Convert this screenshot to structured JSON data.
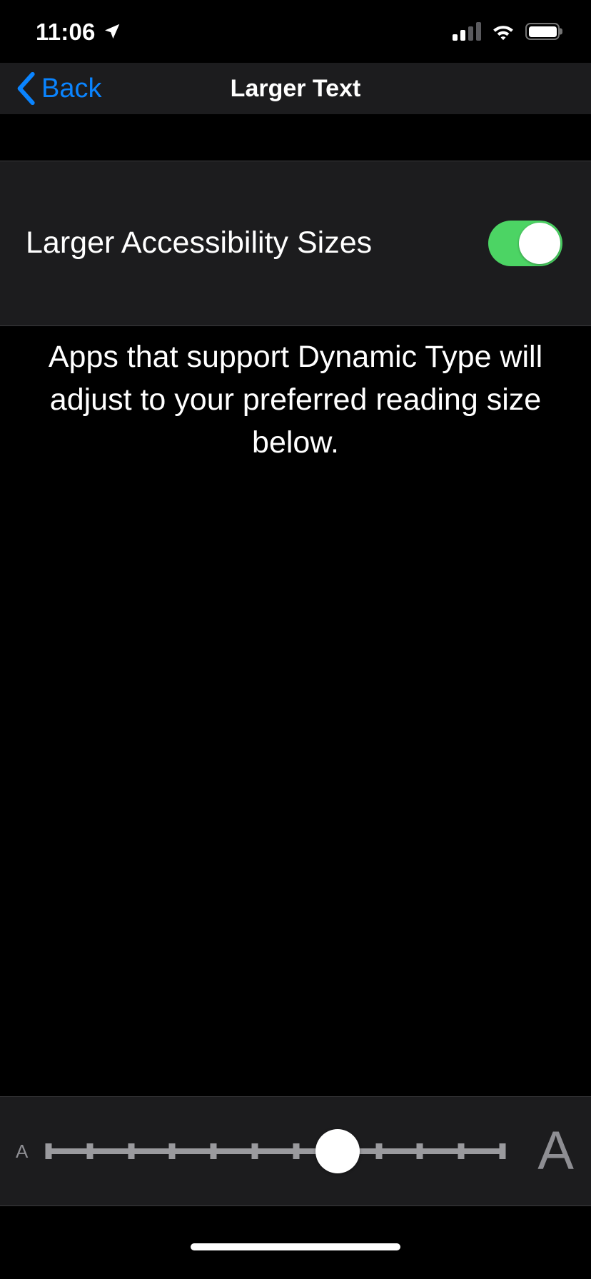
{
  "status_bar": {
    "time": "11:06",
    "location_icon": "location-arrow-icon",
    "cellular_icon": "cellular-bars-icon",
    "cellular_bars_filled": 2,
    "cellular_bars_total": 4,
    "wifi_icon": "wifi-icon",
    "battery_icon": "battery-full-icon",
    "battery_level_percent": 100
  },
  "nav_bar": {
    "back_label": "Back",
    "back_icon": "chevron-left-icon",
    "title": "Larger Text",
    "accent_color": "#0a84ff"
  },
  "settings": {
    "row_label": "Larger Accessibility Sizes",
    "toggle_state": "on",
    "toggle_on_color": "#4cd464",
    "group_background": "#1c1c1e"
  },
  "footer": {
    "text": "Apps that support Dynamic Type will adjust to your preferred reading size below."
  },
  "slider": {
    "min_label": "A",
    "max_label": "A",
    "tick_count": 12,
    "segments": 11,
    "value_index": 7,
    "track_color": "#9a9a9e",
    "thumb_color": "#ffffff",
    "label_color": "#8e8e93"
  },
  "home_indicator": {
    "name": "home-indicator"
  }
}
